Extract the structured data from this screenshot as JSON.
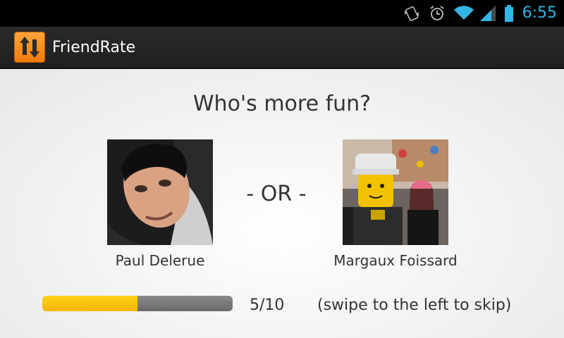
{
  "status_bar": {
    "time": "6:55",
    "time_color": "#33b5e5",
    "icons": [
      "vibrate-icon",
      "alarm-icon",
      "wifi-icon",
      "signal-icon",
      "battery-icon"
    ]
  },
  "action_bar": {
    "app_title": "FriendRate",
    "app_icon": "swap-arrows-icon",
    "accent_color": "#f68b1f"
  },
  "question": "Who's more fun?",
  "candidates": [
    {
      "name": "Paul Delerue"
    },
    {
      "name": "Margaux Foissard"
    }
  ],
  "separator": "- OR -",
  "progress": {
    "current": 5,
    "total": 10,
    "label": "5/10",
    "fill_color": "#ffc400"
  },
  "hint": "(swipe to the left to skip)"
}
